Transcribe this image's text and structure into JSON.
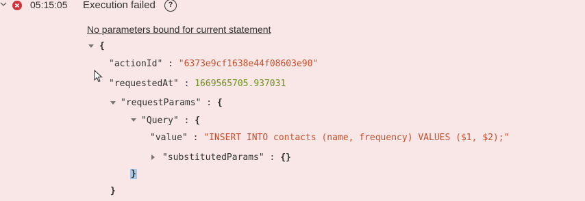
{
  "header": {
    "time": "05:15:05",
    "status": "Execution failed",
    "help": "?"
  },
  "message": "No parameters bound for current statement",
  "json_view": {
    "open_brace": "{",
    "close_brace": "}",
    "action_id_key": "\"actionId\"",
    "action_id_value": "\"6373e9cf1638e44f08603e90\"",
    "requested_at_key": "\"requestedAt\"",
    "requested_at_value": "1669565705.937031",
    "request_params_key": "\"requestParams\"",
    "query_key": "\"Query\"",
    "value_key": "\"value\"",
    "value_value": "\"INSERT INTO contacts (name, frequency) VALUES ($1, $2);\"",
    "substituted_key": "\"substitutedParams\"",
    "empty_object": "{}",
    "sep": " : "
  },
  "colors": {
    "background": "#f9e7e7",
    "error": "#d13438",
    "string": "#c5502c",
    "number": "#6a8f1a"
  }
}
